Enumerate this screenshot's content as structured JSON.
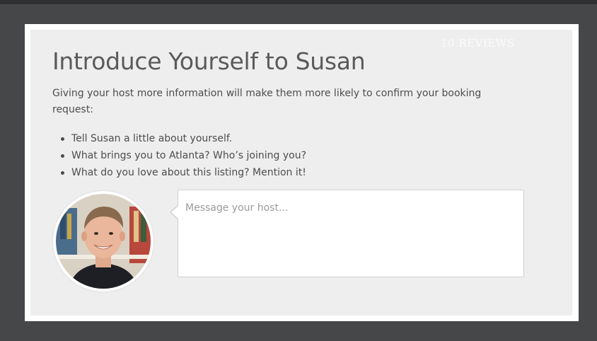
{
  "watermark": "10 REVIEWS",
  "header": {
    "title": "Introduce Yourself to Susan"
  },
  "intro": {
    "text": "Giving your host more information will make them more likely to confirm your booking request:"
  },
  "bullets": [
    "Tell Susan a little about yourself.",
    "What brings you to Atlanta? Who’s joining you?",
    "What do you love about this listing? Mention it!"
  ],
  "message": {
    "placeholder": "Message your host...",
    "value": ""
  },
  "colors": {
    "page_background": "#454749",
    "panel_background": "#eeeeee",
    "text": "#4d4d4d",
    "title": "#5a5a5a",
    "input_border": "#cfcfcf"
  }
}
